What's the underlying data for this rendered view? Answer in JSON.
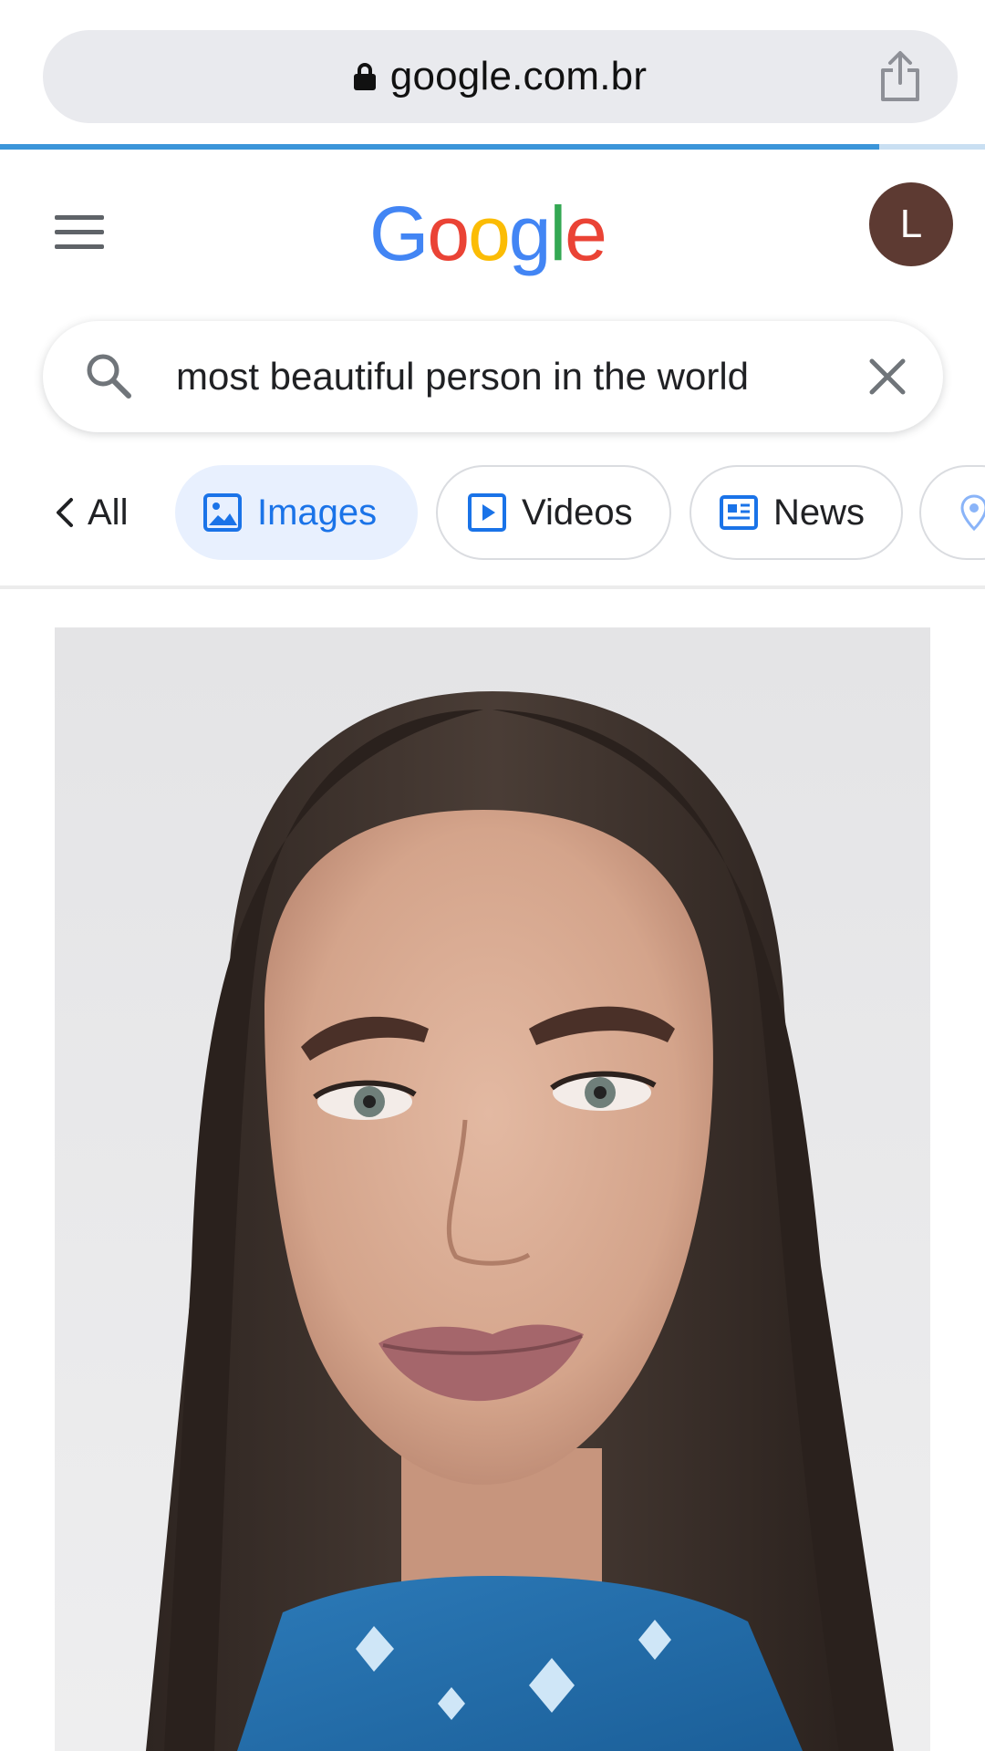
{
  "browser": {
    "url": "google.com.br",
    "lock_icon": "lock-icon",
    "share_icon": "share-icon",
    "load_progress": 0.893
  },
  "header": {
    "menu_icon": "hamburger-menu-icon",
    "logo_letters": [
      "G",
      "o",
      "o",
      "g",
      "l",
      "e"
    ],
    "avatar_initial": "L"
  },
  "search": {
    "query": "most beautiful person in the world",
    "search_icon": "search-icon",
    "clear_icon": "close-icon"
  },
  "tabs": {
    "all_label": "All",
    "items": [
      {
        "label": "Images",
        "icon": "image-icon",
        "active": true
      },
      {
        "label": "Videos",
        "icon": "play-icon",
        "active": false
      },
      {
        "label": "News",
        "icon": "news-icon",
        "active": false
      },
      {
        "label": "",
        "icon": "map-pin-icon",
        "active": false
      }
    ]
  },
  "colors": {
    "accent": "#1a73e8",
    "active_tab_bg": "#e8f0fe",
    "avatar_bg": "#5d3a32",
    "progress": "#3b95d9"
  }
}
